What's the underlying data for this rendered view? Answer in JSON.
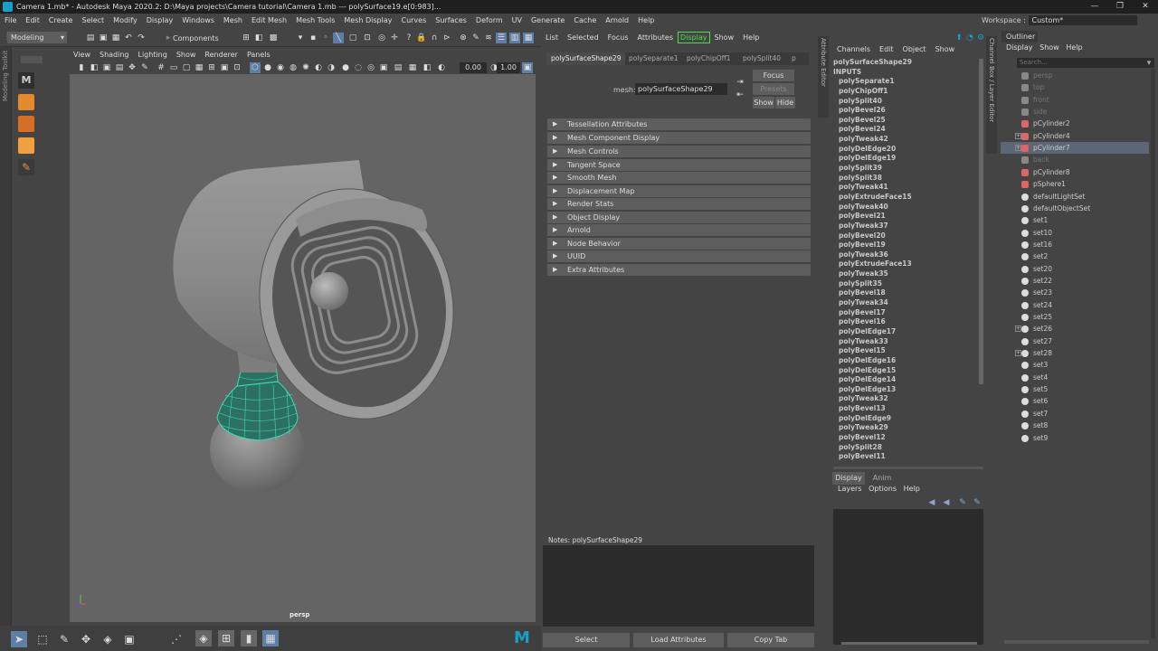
{
  "window": {
    "title": "Camera 1.mb* - Autodesk Maya 2020.2: D:\\Maya projects\\Camera tutorial\\Camera 1.mb  ---  polySurface19.e[0:983]..."
  },
  "menubar": [
    "File",
    "Edit",
    "Create",
    "Select",
    "Modify",
    "Display",
    "Windows",
    "Mesh",
    "Edit Mesh",
    "Mesh Tools",
    "Mesh Display",
    "Curves",
    "Surfaces",
    "Deform",
    "UV",
    "Generate",
    "Cache",
    "Arnold",
    "Help"
  ],
  "workspace": {
    "label": "Workspace :",
    "value": "Custom*"
  },
  "shelf": {
    "mode": "Modeling",
    "components": "Components"
  },
  "viewport": {
    "menu": [
      "View",
      "Shading",
      "Lighting",
      "Show",
      "Renderer",
      "Panels"
    ],
    "val1": "0.00",
    "val2": "1.00",
    "camera": "persp"
  },
  "left": {
    "toolkit": "Modeling Toolkit"
  },
  "ae": {
    "menu": [
      "List",
      "Selected",
      "Focus",
      "Attributes",
      "Display",
      "Show",
      "Help"
    ],
    "tabs": [
      "polySurfaceShape29",
      "polySeparate1",
      "polyChipOff1",
      "polySplit40",
      "p"
    ],
    "mesh_label": "mesh:",
    "mesh_value": "polySurfaceShape29",
    "focus": "Focus",
    "presets": "Presets",
    "show": "Show",
    "hide": "Hide",
    "sections": [
      "Tessellation Attributes",
      "Mesh Component Display",
      "Mesh Controls",
      "Tangent Space",
      "Smooth Mesh",
      "Displacement Map",
      "Render Stats",
      "Object Display",
      "Arnold",
      "Node Behavior",
      "UUID",
      "Extra Attributes"
    ],
    "notes": "Notes:  polySurfaceShape29",
    "buttons": [
      "Select",
      "Load Attributes",
      "Copy Tab"
    ],
    "side_tab": "Attribute Editor"
  },
  "cb": {
    "menu": [
      "Channels",
      "Edit",
      "Object",
      "Show"
    ],
    "shape": "polySurfaceShape29",
    "inputs": "INPUTS",
    "items": [
      "polySeparate1",
      "polyChipOff1",
      "polySplit40",
      "polyBevel26",
      "polyBevel25",
      "polyBevel24",
      "polyTweak42",
      "polyDelEdge20",
      "polyDelEdge19",
      "polySplit39",
      "polySplit38",
      "polyTweak41",
      "polyExtrudeFace15",
      "polyTweak40",
      "polyBevel21",
      "polyTweak37",
      "polyBevel20",
      "polyBevel19",
      "polyTweak36",
      "polyExtrudeFace13",
      "polyTweak35",
      "polySplit35",
      "polyBevel18",
      "polyTweak34",
      "polyBevel17",
      "polyBevel16",
      "polyDelEdge17",
      "polyTweak33",
      "polyBevel15",
      "polyDelEdge16",
      "polyDelEdge15",
      "polyDelEdge14",
      "polyDelEdge13",
      "polyTweak32",
      "polyBevel13",
      "polyDelEdge9",
      "polyTweak29",
      "polyBevel12",
      "polySplit28",
      "polyBevel11"
    ],
    "layer_tabs": [
      "Display",
      "Anim"
    ],
    "layer_menu": [
      "Layers",
      "Options",
      "Help"
    ],
    "side_tab": "Channel Box / Layer Editor"
  },
  "outliner": {
    "title": "Outliner",
    "menu": [
      "Display",
      "Show",
      "Help"
    ],
    "search": "Search...",
    "items": [
      {
        "label": "persp",
        "kind": "cam",
        "dim": true
      },
      {
        "label": "top",
        "kind": "cam",
        "dim": true
      },
      {
        "label": "front",
        "kind": "cam",
        "dim": true
      },
      {
        "label": "side",
        "kind": "cam",
        "dim": true
      },
      {
        "label": "pCylinder2",
        "kind": "mesh"
      },
      {
        "label": "pCylinder4",
        "kind": "mesh",
        "exp": true
      },
      {
        "label": "pCylinder7",
        "kind": "mesh",
        "exp": true,
        "sel": true
      },
      {
        "label": "back",
        "kind": "cam",
        "dim": true
      },
      {
        "label": "pCylinder8",
        "kind": "mesh"
      },
      {
        "label": "pSphere1",
        "kind": "mesh"
      },
      {
        "label": "defaultLightSet",
        "kind": "set"
      },
      {
        "label": "defaultObjectSet",
        "kind": "set"
      },
      {
        "label": "set1",
        "kind": "set"
      },
      {
        "label": "set10",
        "kind": "set"
      },
      {
        "label": "set16",
        "kind": "set"
      },
      {
        "label": "set2",
        "kind": "set"
      },
      {
        "label": "set20",
        "kind": "set"
      },
      {
        "label": "set22",
        "kind": "set"
      },
      {
        "label": "set23",
        "kind": "set"
      },
      {
        "label": "set24",
        "kind": "set"
      },
      {
        "label": "set25",
        "kind": "set"
      },
      {
        "label": "set26",
        "kind": "set",
        "exp": true
      },
      {
        "label": "set27",
        "kind": "set"
      },
      {
        "label": "set28",
        "kind": "set",
        "exp": true
      },
      {
        "label": "set3",
        "kind": "set"
      },
      {
        "label": "set4",
        "kind": "set"
      },
      {
        "label": "set5",
        "kind": "set"
      },
      {
        "label": "set6",
        "kind": "set"
      },
      {
        "label": "set7",
        "kind": "set"
      },
      {
        "label": "set8",
        "kind": "set"
      },
      {
        "label": "set9",
        "kind": "set"
      }
    ]
  },
  "colors": {
    "accent": "#16a1c9",
    "highlight_green": "#4cdc4c",
    "selection": "#5c6677",
    "wire": "#3ee0b4"
  }
}
